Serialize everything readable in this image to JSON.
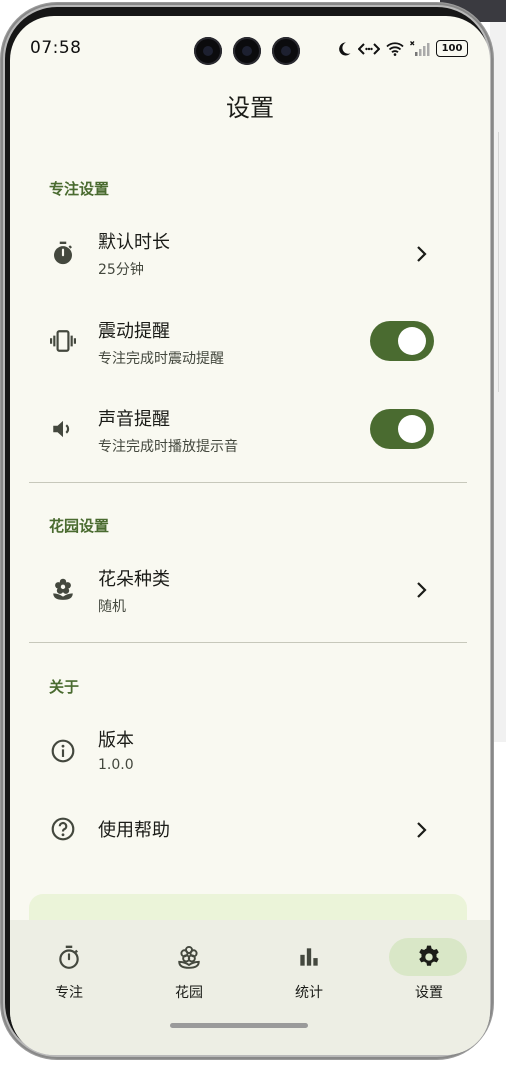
{
  "status_bar": {
    "time": "07:58",
    "battery": "100"
  },
  "header": {
    "title": "设置"
  },
  "sections": {
    "focus": {
      "title": "专注设置",
      "duration": {
        "title": "默认时长",
        "subtitle": "25分钟",
        "icon": "stopwatch-icon"
      },
      "vibration": {
        "title": "震动提醒",
        "subtitle": "专注完成时震动提醒",
        "icon": "vibration-icon",
        "on": true
      },
      "sound": {
        "title": "声音提醒",
        "subtitle": "专注完成时播放提示音",
        "icon": "volume-icon",
        "on": true
      }
    },
    "garden": {
      "title": "花园设置",
      "flower_type": {
        "title": "花朵种类",
        "subtitle": "随机",
        "icon": "flower-icon"
      }
    },
    "about": {
      "title": "关于",
      "version": {
        "title": "版本",
        "subtitle": "1.0.0",
        "icon": "info-icon"
      },
      "help": {
        "title": "使用帮助",
        "icon": "help-circle-icon"
      }
    }
  },
  "bottom_nav": {
    "items": [
      {
        "label": "专注",
        "icon": "timer-icon",
        "active": false
      },
      {
        "label": "花园",
        "icon": "flower-outline-icon",
        "active": false
      },
      {
        "label": "统计",
        "icon": "bar-chart-icon",
        "active": false
      },
      {
        "label": "设置",
        "icon": "gear-icon",
        "active": true
      }
    ]
  },
  "colors": {
    "accent": "#4a6b30",
    "background": "#f9f9f1",
    "nav_background": "#edeee4",
    "active_pill": "#d9e7c7",
    "section_title": "#4a6b30"
  }
}
